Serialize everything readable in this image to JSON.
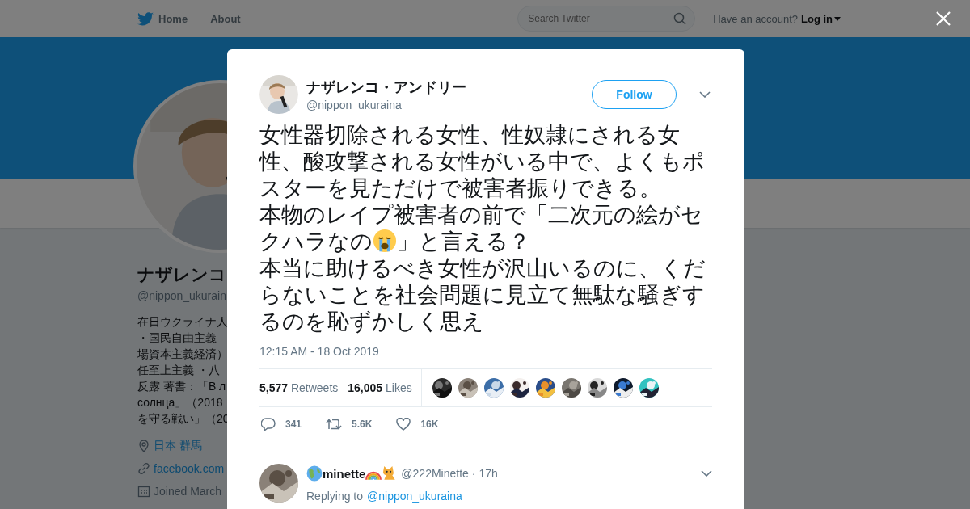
{
  "topbar": {
    "nav": [
      "Home",
      "About"
    ],
    "search": {
      "placeholder": "Search Twitter"
    },
    "account_prompt": "Have an account?",
    "login": "Log in"
  },
  "profile": {
    "name": "ナザレンコ",
    "handle": "@nippon_ukurain",
    "bio_lines": [
      "在日ウクライナ人",
      "・国民自由主義",
      "場資本主義経済）",
      "任至上主義 ・八",
      "反露 著書：「В л",
      "солнца」（2018",
      "を守る戦い」（20"
    ],
    "location": "日本 群馬",
    "website": "facebook.com",
    "joined": "Joined March"
  },
  "tweet": {
    "author": {
      "name": "ナザレンコ・アンドリー",
      "handle": "@nippon_ukuraina"
    },
    "follow": "Follow",
    "paragraphs": [
      [
        {
          "kind": "text",
          "text": "女性器切除される女性、性奴隷にされる女性、酸攻撃される女性がいる中で、よくもポスターを見ただけで被害者振りできる。"
        }
      ],
      [
        {
          "kind": "text",
          "text": "本物のレイプ被害者の前で「二次元の絵がセ"
        },
        {
          "kind": "break"
        },
        {
          "kind": "text",
          "text": "クハラなの"
        },
        {
          "kind": "crying_face"
        },
        {
          "kind": "text",
          "text": "」と言える？"
        }
      ],
      [
        {
          "kind": "text",
          "text": "本当に助けるべき女性が沢山いるのに、くだらないことを社会問題に見立て無駄な騒ぎするのを恥ずかしく思え"
        }
      ]
    ],
    "timestamp": "12:15 AM - 18 Oct 2019",
    "stats": [
      {
        "count": "5,577",
        "label": "Retweets"
      },
      {
        "count": "16,005",
        "label": "Likes"
      }
    ],
    "likers": [
      {
        "kind": "picture"
      },
      {
        "kind": "picture"
      },
      {
        "kind": "picture"
      },
      {
        "kind": "picture"
      },
      {
        "kind": "picture"
      },
      {
        "kind": "picture"
      },
      {
        "kind": "picture"
      },
      {
        "kind": "picture"
      },
      {
        "kind": "picture"
      }
    ],
    "actions": [
      {
        "kind": "reply",
        "count": "341"
      },
      {
        "kind": "retweet",
        "count": "5.6K"
      },
      {
        "kind": "like",
        "count": "16K"
      }
    ]
  },
  "reply": {
    "name": [
      {
        "kind": "globe"
      },
      {
        "kind": "text",
        "text": "minette"
      },
      {
        "kind": "rainbow"
      },
      {
        "kind": "cat"
      }
    ],
    "handle": "@222Minette",
    "separator": "·",
    "time": "17h",
    "replying_label": "Replying to",
    "replying_to": "@nippon_ukuraina"
  }
}
